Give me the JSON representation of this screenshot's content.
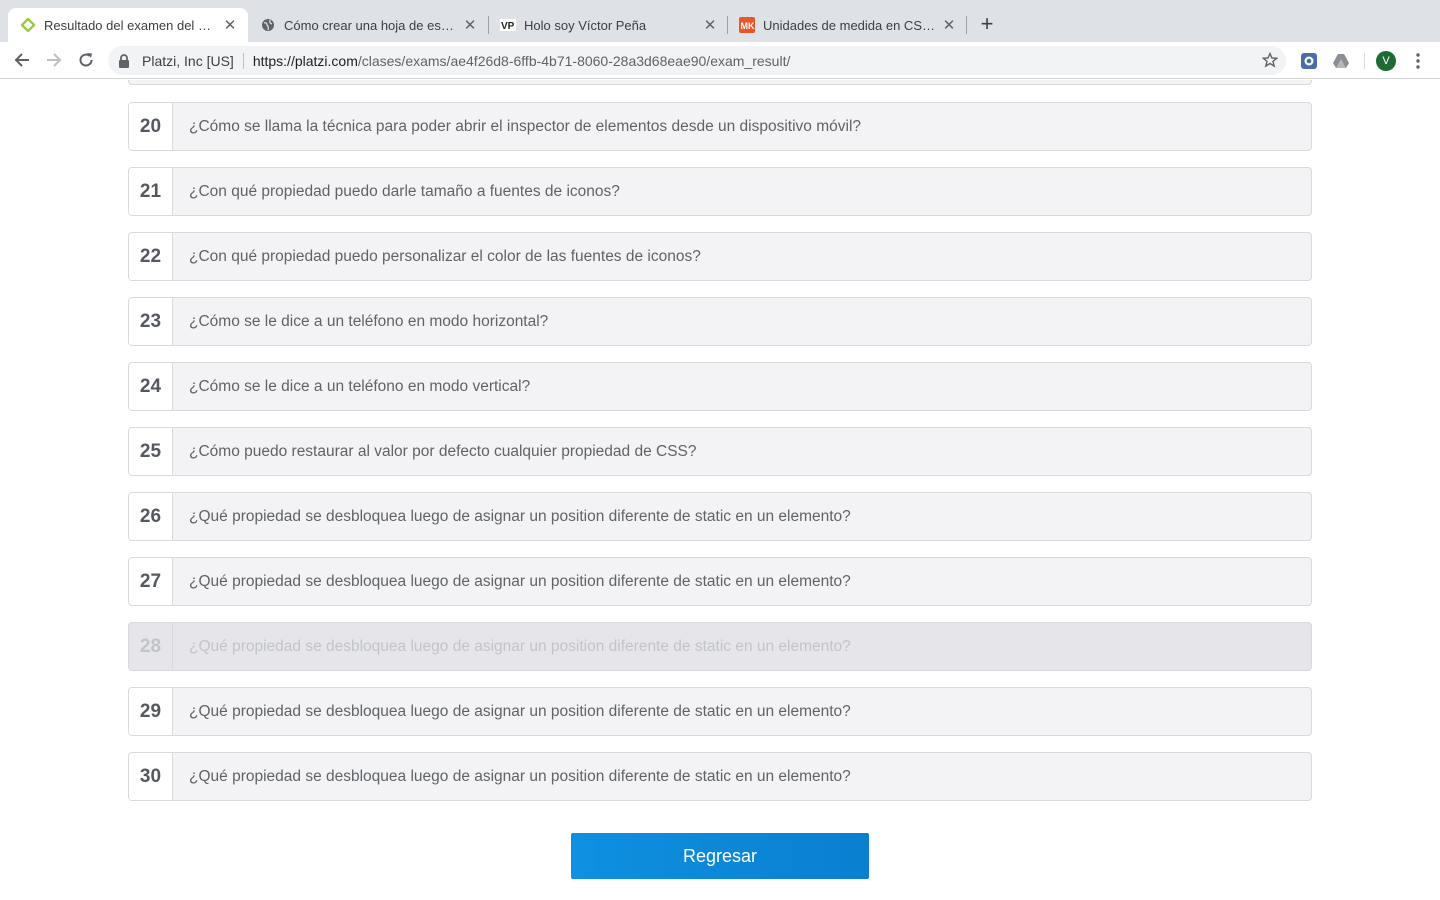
{
  "browser": {
    "tabs": [
      {
        "title": "Resultado del examen del Curs",
        "active": true,
        "favicon": "platzi-icon"
      },
      {
        "title": "Cómo crear una hoja de estilo p",
        "active": false,
        "favicon": "globe-icon"
      },
      {
        "title": "Holo soy Víctor Peña",
        "active": false,
        "favicon": "vp-icon"
      },
      {
        "title": "Unidades de medida en CSS (P",
        "active": false,
        "favicon": "mk-icon"
      }
    ],
    "site_identity": "Platzi, Inc [US]",
    "url_host": "https://platzi.com",
    "url_path": "/clases/exams/ae4f26d8-6ffb-4b71-8060-28a3d68eae90/exam_result/",
    "profile_initial": "V"
  },
  "questions": [
    {
      "number": "20",
      "text": "¿Cómo se llama la técnica para poder abrir el inspector de elementos desde un dispositivo móvil?"
    },
    {
      "number": "21",
      "text": "¿Con qué propiedad puedo darle tamaño a fuentes de iconos?"
    },
    {
      "number": "22",
      "text": "¿Con qué propiedad puedo personalizar el color de las fuentes de iconos?"
    },
    {
      "number": "23",
      "text": "¿Cómo se le dice a un teléfono en modo horizontal?"
    },
    {
      "number": "24",
      "text": "¿Cómo se le dice a un teléfono en modo vertical?"
    },
    {
      "number": "25",
      "text": "¿Cómo puedo restaurar al valor por defecto cualquier propiedad de CSS?"
    },
    {
      "number": "26",
      "text": "¿Qué propiedad se desbloquea luego de asignar un position diferente de static en un elemento?"
    },
    {
      "number": "27",
      "text": "¿Qué propiedad se desbloquea luego de asignar un position diferente de static en un elemento?"
    },
    {
      "number": "28",
      "text": "¿Qué propiedad se desbloquea luego de asignar un position diferente de static en un elemento?"
    },
    {
      "number": "29",
      "text": "¿Qué propiedad se desbloquea luego de asignar un position diferente de static en un elemento?"
    },
    {
      "number": "30",
      "text": "¿Qué propiedad se desbloquea luego de asignar un position diferente de static en un elemento?"
    }
  ],
  "back_button_label": "Regresar",
  "colors": {
    "accent": "#0b86d6",
    "tabstrip": "#dee1e6",
    "row_bg": "#f3f3f5"
  }
}
